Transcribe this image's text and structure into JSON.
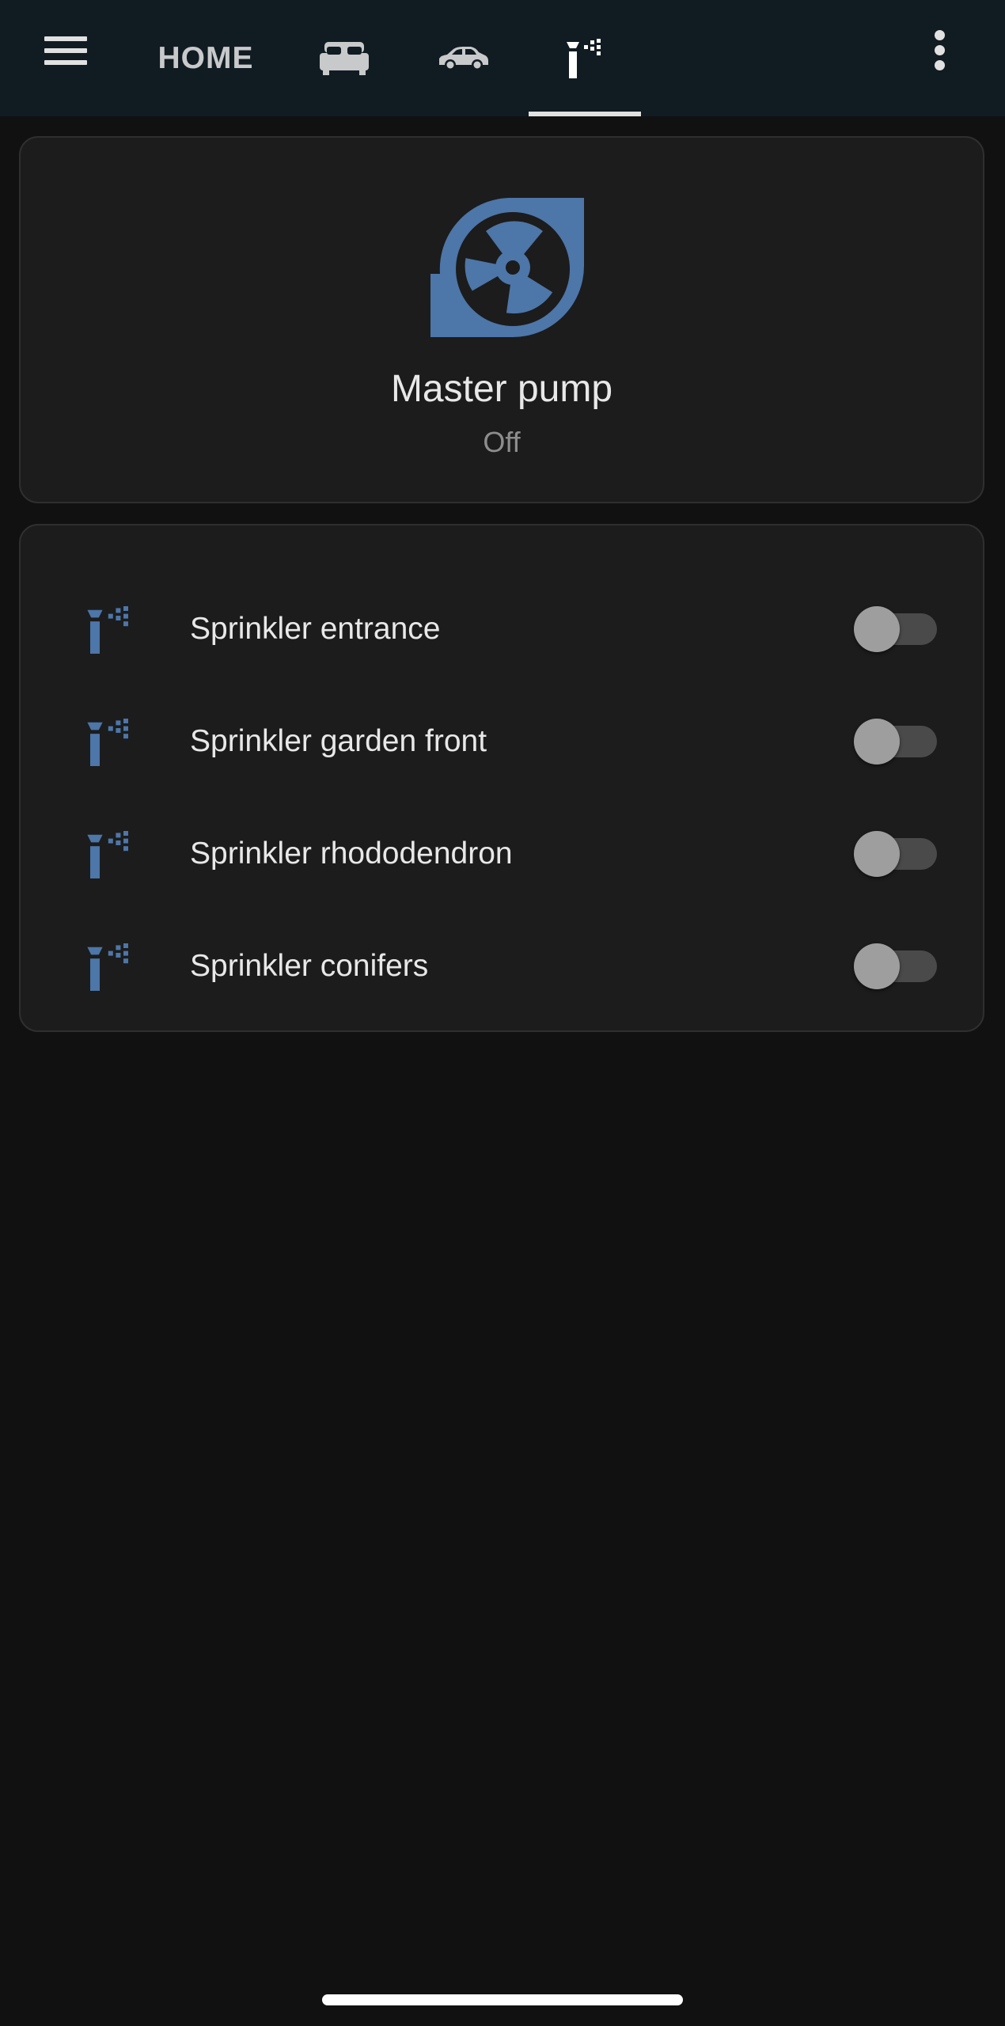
{
  "header": {
    "home_tab_label": "HOME",
    "tabs": [
      {
        "icon": "bed-icon"
      },
      {
        "icon": "car-icon"
      },
      {
        "icon": "sprinkler-icon",
        "active": true
      }
    ]
  },
  "pump": {
    "name": "Master pump",
    "state": "Off",
    "icon": "pump-icon",
    "icon_color": "#4d76a9"
  },
  "sprinklers": [
    {
      "label": "Sprinkler entrance",
      "on": false
    },
    {
      "label": "Sprinkler garden front",
      "on": false
    },
    {
      "label": "Sprinkler rhododendron",
      "on": false
    },
    {
      "label": "Sprinkler conifers",
      "on": false
    }
  ],
  "colors": {
    "accent": "#4d76a9",
    "app_bar": "#111b22",
    "card": "#1c1c1c",
    "background": "#111111"
  }
}
